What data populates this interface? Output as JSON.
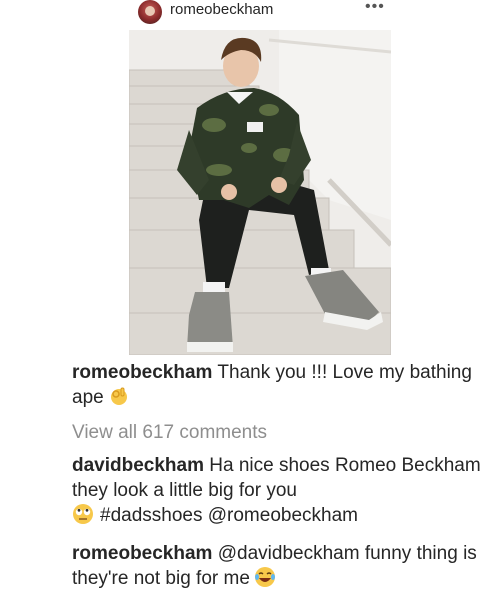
{
  "header": {
    "username": "romeobeckham",
    "more_icon": "•••"
  },
  "photo": {
    "icon": "post-photo-boy-on-stairs",
    "colors": {
      "camo_dark": "#2c3626",
      "camo_light": "#5a6b3f",
      "pants": "#1d1f1d",
      "stairs": "#d9d6d0",
      "wall": "#eeece9"
    }
  },
  "caption": {
    "user": "romeobeckham",
    "text": "Thank you !!! Love my bathing ape",
    "emoji": "ok-hand-emoji"
  },
  "view_all": "View all 617 comments",
  "comments": [
    {
      "user": "davidbeckham",
      "text": "Ha nice shoes Romeo Beckham they look a little big for you",
      "emoji": "rolling-eyes-emoji",
      "hashtag": "#dadsshoes",
      "mention": "@romeobeckham"
    },
    {
      "user": "romeobeckham",
      "mention": "@davidbeckham",
      "text": "funny thing is they're not big for me",
      "emoji": "tears-of-joy-emoji"
    }
  ]
}
